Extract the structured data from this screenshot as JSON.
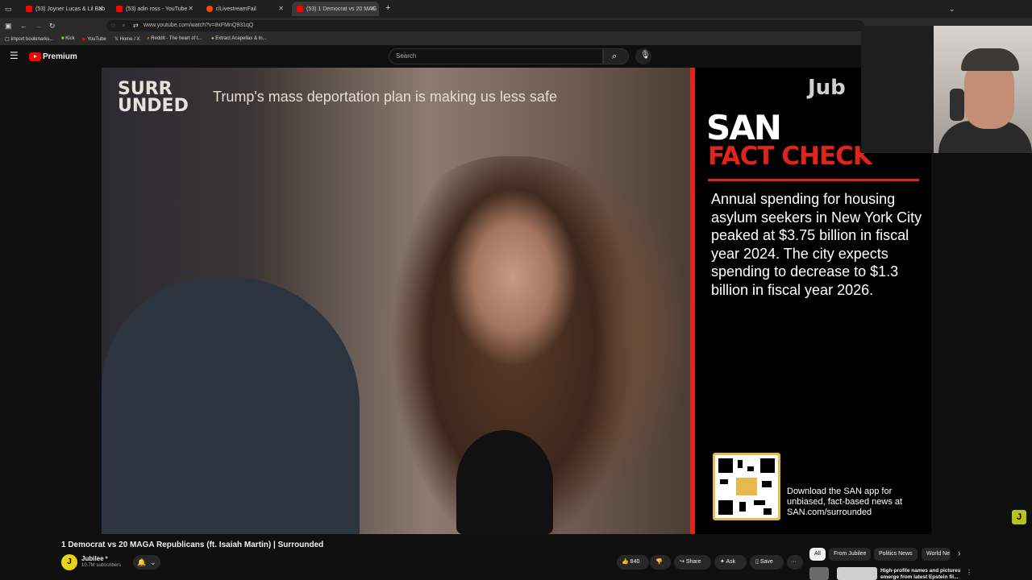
{
  "browser": {
    "tabs": [
      {
        "label": "(53) Joyner Lucas & Lil Bab",
        "active": false
      },
      {
        "label": "(53) adin ross - YouTube",
        "active": false
      },
      {
        "label": "r/LivestreamFail",
        "active": false
      },
      {
        "label": "(53) 1 Democrat vs 20 MAG",
        "active": true
      }
    ],
    "new_tab": "+",
    "url": "www.youtube.com/watch?v=8xFMnQ931qQ",
    "bookmarks": [
      "Import bookmarks...",
      "Kick",
      "YouTube",
      "Home / X",
      "Reddit - The heart of t...",
      "Extract Acapellas & In..."
    ]
  },
  "youtube": {
    "logo_text": "Premium",
    "search_placeholder": "Search",
    "accent": "#ff0000"
  },
  "video": {
    "brand": "SURR UNDED",
    "subtitle": "Trump's mass deportation plan is making us less safe",
    "corner_logo": "Jub",
    "san_logo": "SAN",
    "fact_check_label": "FACT CHECK",
    "fact_check_text": "Annual spending for housing asylum seekers in New York City peaked at $3.75 billion in fiscal year 2024. The city expects spending to decrease to $1.3 billion in fiscal year 2026.",
    "download_text": "Download the SAN app for unbiased, fact-based news at SAN.com/surrounded",
    "accent_red": "#e0241b"
  },
  "below": {
    "title": "1 Democrat vs 20 MAGA Republicans (ft. Isaiah Martin) | Surrounded",
    "channel": "Jubilee",
    "subscribers": "10.7M subscribers",
    "likes": "840",
    "share": "Share",
    "ask": "Ask",
    "save": "Save",
    "more": "···",
    "chips": [
      "All",
      "From Jubilee",
      "Politics News",
      "World Ne"
    ],
    "rec_title": "High-profile names and pictures emerge from latest Epstein fil..."
  }
}
